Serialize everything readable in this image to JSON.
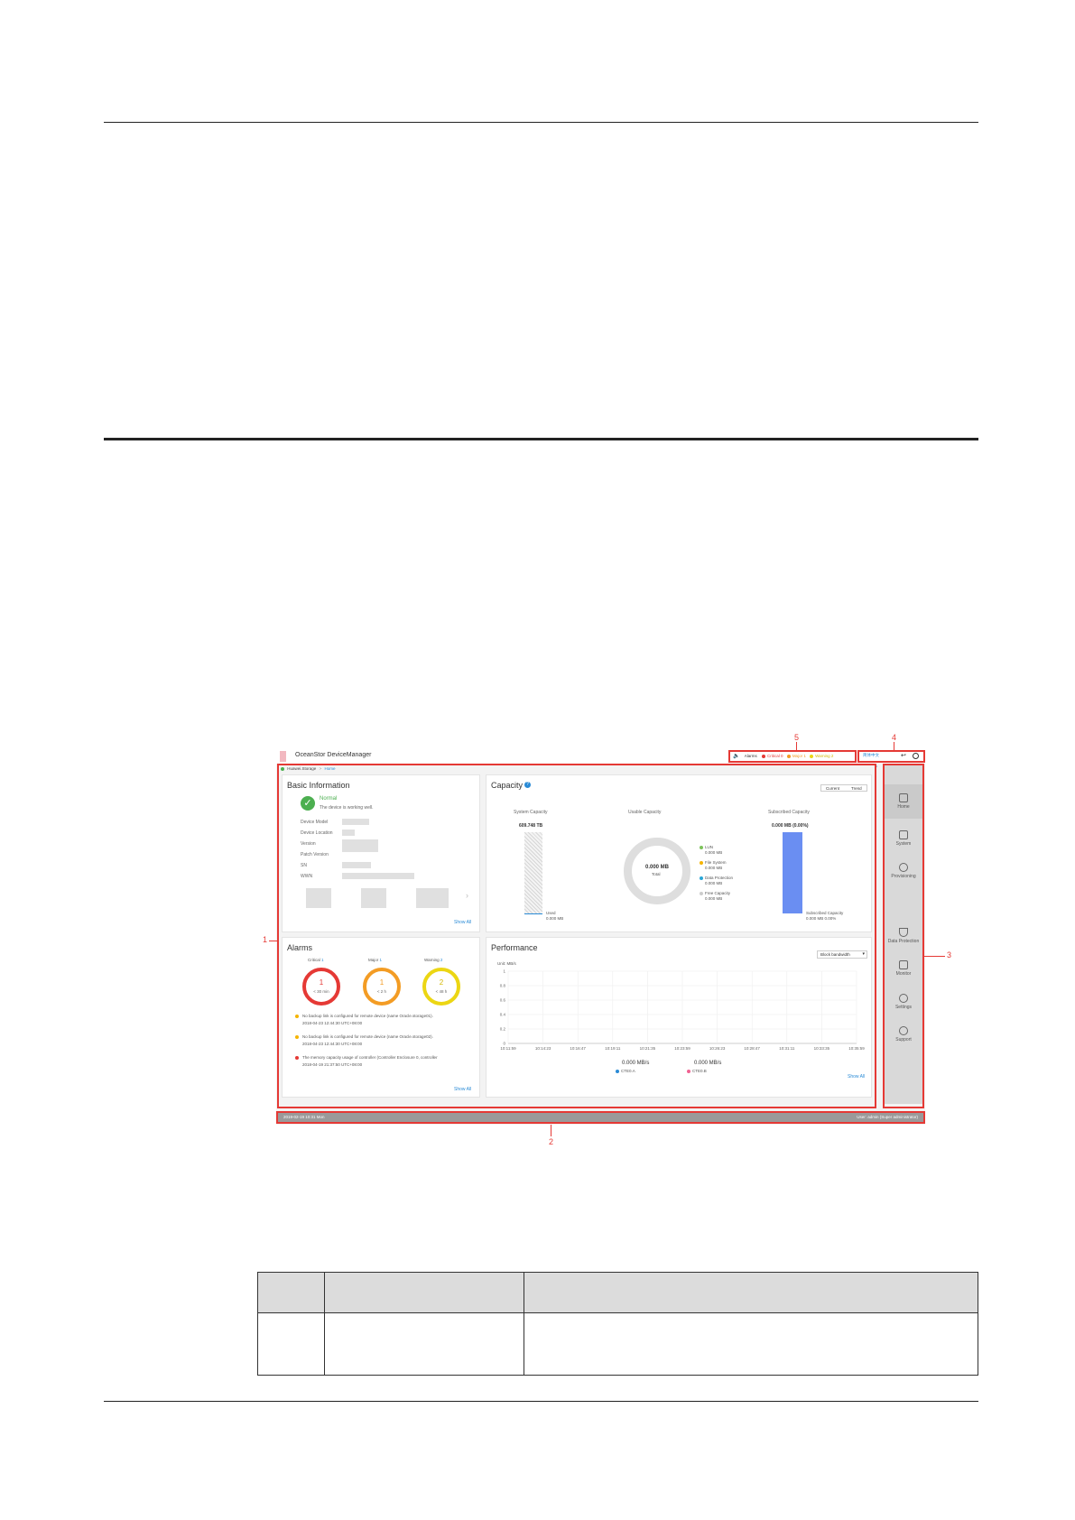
{
  "app": {
    "title": "OceanStor DeviceManager",
    "breadcrumb_root": "Huawei.Storage",
    "breadcrumb_sep": ">",
    "breadcrumb_current": "Home",
    "header_alarms": "Alarms",
    "header_critical": "Critical 0",
    "header_major": "Major 1",
    "header_warning": "Warning 2",
    "header_lang": "简体中文"
  },
  "basic_info": {
    "title": "Basic Information",
    "status": "Normal",
    "status_desc": "The device is working well.",
    "fields": [
      "Device Model",
      "Device Location",
      "Version",
      "Patch Version",
      "SN",
      "WWN"
    ],
    "show_all": "Show All"
  },
  "capacity": {
    "title": "Capacity",
    "tab_current": "Current",
    "tab_trend": "Trend",
    "system_label": "System Capacity",
    "system_value": "609.748 TB",
    "used_label": "Used",
    "used_value": "0.000 MB",
    "usable_label": "Usable Capacity",
    "donut_value": "0.000 MB",
    "donut_sub": "Total",
    "legend": [
      {
        "name": "LUN",
        "value": "0.000 MB",
        "color": "#7cc35a"
      },
      {
        "name": "File System",
        "value": "0.000 MB",
        "color": "#f5b400"
      },
      {
        "name": "Data Protection",
        "value": "0.000 MB",
        "color": "#2aa6d6"
      },
      {
        "name": "Free Capacity",
        "value": "0.000 MB",
        "color": "#cccccc"
      }
    ],
    "subscribed_label": "Subscribed Capacity",
    "subscribed_value": "0.000 MB (0.00%)",
    "subscribed_legend": "Subscribed Capacity",
    "subscribed_legend_value": "0.000 MB  0.00%"
  },
  "alarms": {
    "title": "Alarms",
    "critical": {
      "label": "Critical",
      "count": "1",
      "ring": "1",
      "sub": "< 30 min",
      "color": "#e53935"
    },
    "major": {
      "label": "Major",
      "count": "1",
      "ring": "1",
      "sub": "< 2 h",
      "color": "#f39c24"
    },
    "warning": {
      "label": "Warning",
      "count": "2",
      "ring": "2",
      "sub": "< 48 h",
      "color": "#ecd613"
    },
    "items": [
      {
        "text": "No backup link is configured for remote device (name Oracle.storage01).",
        "time": "2018-04-23 12:44:30 UTC+08:00",
        "color": "#f5b400"
      },
      {
        "text": "No backup link is configured for remote device (name Oracle.storage02).",
        "time": "2018-04-23 12:44:30 UTC+08:00",
        "color": "#f5b400"
      },
      {
        "text": "The memory capacity usage of controller (Controller Enclosure 0, controller",
        "time": "2018-04-19 21:37:50 UTC+08:00",
        "color": "#e53935"
      }
    ],
    "show_all": "Show All"
  },
  "performance": {
    "title": "Performance",
    "select": "Block bandwidth",
    "unit": "Unit: MB/s",
    "y_ticks": [
      "1",
      "0.8",
      "0.6",
      "0.4",
      "0.2",
      "0"
    ],
    "x_ticks": [
      "10:11:59",
      "10:14:23",
      "10:16:47",
      "10:19:11",
      "10:21:35",
      "10:23:59",
      "10:26:23",
      "10:28:47",
      "10:31:11",
      "10:33:35",
      "10:35:59"
    ],
    "ctea_value": "0.000 MB/s",
    "ctea_label": "CTE0.A",
    "cteb_value": "0.000 MB/s",
    "cteb_label": "CTE0.B",
    "show_all": "Show All"
  },
  "sidebar": {
    "items": [
      {
        "label": "Home"
      },
      {
        "label": "System"
      },
      {
        "label": "Provisioning"
      },
      {
        "label": "Data Protection"
      },
      {
        "label": "Monitor"
      },
      {
        "label": "Settings"
      },
      {
        "label": "Support"
      }
    ]
  },
  "statusbar": {
    "left": "2019-02-19 10:31 Mon",
    "right": "User: admin (Super administrator)"
  },
  "callouts": {
    "c1": "1",
    "c2": "2",
    "c3": "3",
    "c4": "4",
    "c5": "5"
  }
}
